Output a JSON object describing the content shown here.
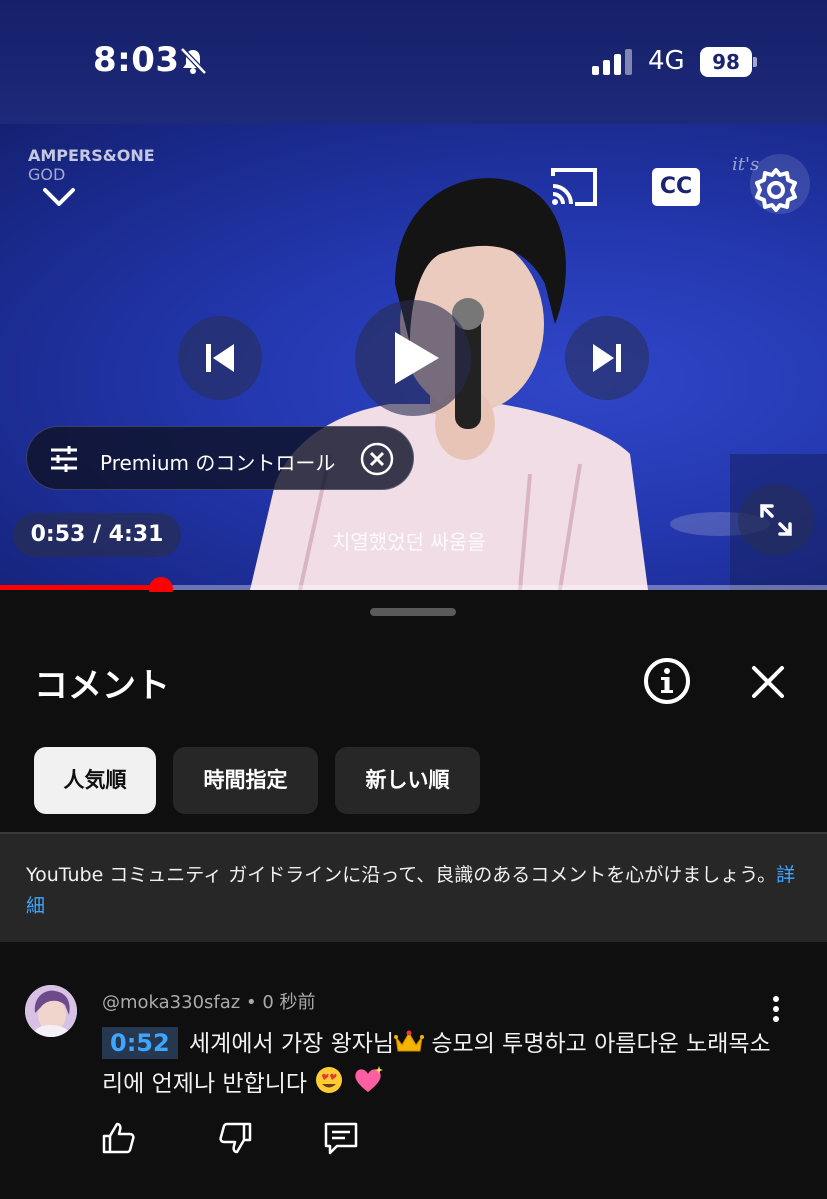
{
  "status_bar": {
    "time": "8:03",
    "network": "4G",
    "battery": "98"
  },
  "video": {
    "channel_brand": "AMPERS&ONE",
    "song": "GOD",
    "watermark": "it's",
    "cc_label": "CC",
    "premium_controls_label": "Premium のコントロール",
    "time_display": "0:53 / 4:31",
    "subtitle": "치열했었던 싸움을",
    "progress_fraction": 0.195,
    "accent_color": "#ff0000"
  },
  "comments_panel": {
    "title": "コメント",
    "chips": [
      {
        "label": "人気順",
        "active": true
      },
      {
        "label": "時間指定",
        "active": false
      },
      {
        "label": "新しい順",
        "active": false
      }
    ],
    "guidelines_text": "YouTube コミュニティ ガイドラインに沿って、良識のあるコメントを心がけましょう。",
    "guidelines_link": "詳細",
    "comment": {
      "author": "@moka330sfaz",
      "age": "0 秒前",
      "timestamp": "0:52",
      "text_part1": " 세계에서 가장 왕자님",
      "text_part2": " 승모의 투명하고 아름다운 노래목소리에 언제나 반합니다"
    }
  }
}
